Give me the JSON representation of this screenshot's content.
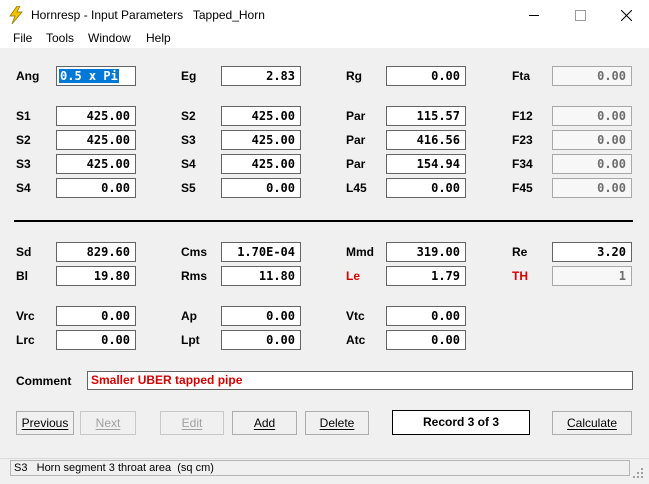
{
  "window": {
    "title": "Hornresp - Input Parameters   Tapped_Horn"
  },
  "menu": [
    "File",
    "Tools",
    "Window",
    "Help"
  ],
  "params": {
    "Ang": {
      "label": "Ang",
      "value": "0.5 x Pi"
    },
    "Eg": {
      "label": "Eg",
      "value": "2.83"
    },
    "Rg": {
      "label": "Rg",
      "value": "0.00"
    },
    "Fta": {
      "label": "Fta",
      "value": "0.00"
    },
    "S1": {
      "label": "S1",
      "value": "425.00"
    },
    "S2a": {
      "label": "S2",
      "value": "425.00"
    },
    "Par1": {
      "label": "Par",
      "value": "115.57"
    },
    "F12": {
      "label": "F12",
      "value": "0.00"
    },
    "S2b": {
      "label": "S2",
      "value": "425.00"
    },
    "S3a": {
      "label": "S3",
      "value": "425.00"
    },
    "Par2": {
      "label": "Par",
      "value": "416.56"
    },
    "F23": {
      "label": "F23",
      "value": "0.00"
    },
    "S3b": {
      "label": "S3",
      "value": "425.00"
    },
    "S4a": {
      "label": "S4",
      "value": "425.00"
    },
    "Par3": {
      "label": "Par",
      "value": "154.94"
    },
    "F34": {
      "label": "F34",
      "value": "0.00"
    },
    "S4b": {
      "label": "S4",
      "value": "0.00"
    },
    "S5": {
      "label": "S5",
      "value": "0.00"
    },
    "L45": {
      "label": "L45",
      "value": "0.00"
    },
    "F45": {
      "label": "F45",
      "value": "0.00"
    },
    "Sd": {
      "label": "Sd",
      "value": "829.60"
    },
    "Cms": {
      "label": "Cms",
      "value": "1.70E-04"
    },
    "Mmd": {
      "label": "Mmd",
      "value": "319.00"
    },
    "Re": {
      "label": "Re",
      "value": "3.20"
    },
    "Bl": {
      "label": "Bl",
      "value": "19.80"
    },
    "Rms": {
      "label": "Rms",
      "value": "11.80"
    },
    "Le": {
      "label": "Le",
      "value": "1.79"
    },
    "TH": {
      "label": "TH",
      "value": "1"
    },
    "Vrc": {
      "label": "Vrc",
      "value": "0.00"
    },
    "Ap": {
      "label": "Ap",
      "value": "0.00"
    },
    "Vtc": {
      "label": "Vtc",
      "value": "0.00"
    },
    "Lrc": {
      "label": "Lrc",
      "value": "0.00"
    },
    "Lpt": {
      "label": "Lpt",
      "value": "0.00"
    },
    "Atc": {
      "label": "Atc",
      "value": "0.00"
    }
  },
  "comment": {
    "label": "Comment",
    "value": "Smaller UBER tapped pipe"
  },
  "buttons": {
    "previous": "Previous",
    "next": "Next",
    "edit": "Edit",
    "add": "Add",
    "delete": "Delete",
    "calculate": "Calculate"
  },
  "record": "Record 3 of 3",
  "status": "S3   Horn segment 3 throat area  (sq cm)",
  "colors": {
    "highlight_label": "#d40000",
    "selection": "#0078d7",
    "icon_yellow": "#f2c500"
  },
  "icons": [
    "hornresp-app-icon",
    "minimize-icon",
    "maximize-icon",
    "close-icon",
    "resize-grip-icon"
  ]
}
